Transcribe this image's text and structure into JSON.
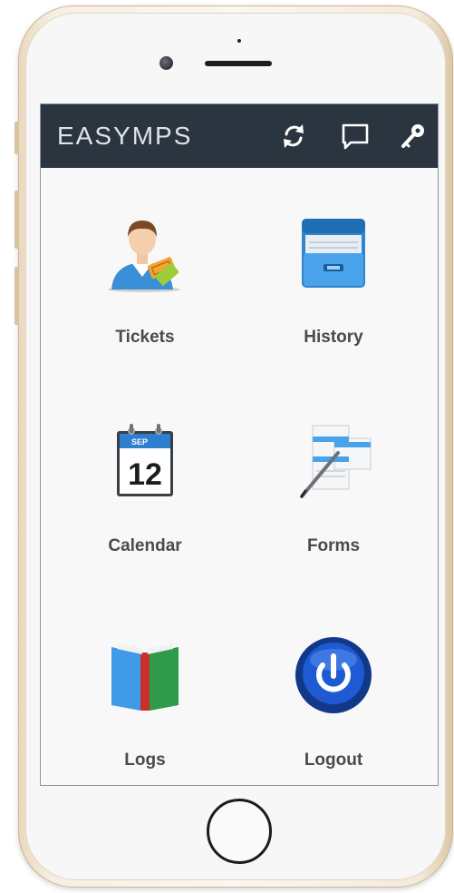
{
  "app": {
    "brand": "EASYMPS"
  },
  "toolbar": {
    "refresh_icon": "refresh-icon",
    "message_icon": "chat-icon",
    "key_icon": "key-icon"
  },
  "menu": [
    {
      "label": "Tickets",
      "icon": "user-tickets-icon"
    },
    {
      "label": "History",
      "icon": "file-cabinet-icon"
    },
    {
      "label": "Calendar",
      "icon": "calendar-icon"
    },
    {
      "label": "Forms",
      "icon": "forms-icon"
    },
    {
      "label": "Logs",
      "icon": "book-icon"
    },
    {
      "label": "Logout",
      "icon": "power-icon"
    }
  ],
  "calendar_icon": {
    "month": "SEP",
    "day": "12"
  },
  "colors": {
    "app_bar": "#2b3540",
    "label": "#4a4a4a",
    "phone_frame": "#f7efe2"
  }
}
